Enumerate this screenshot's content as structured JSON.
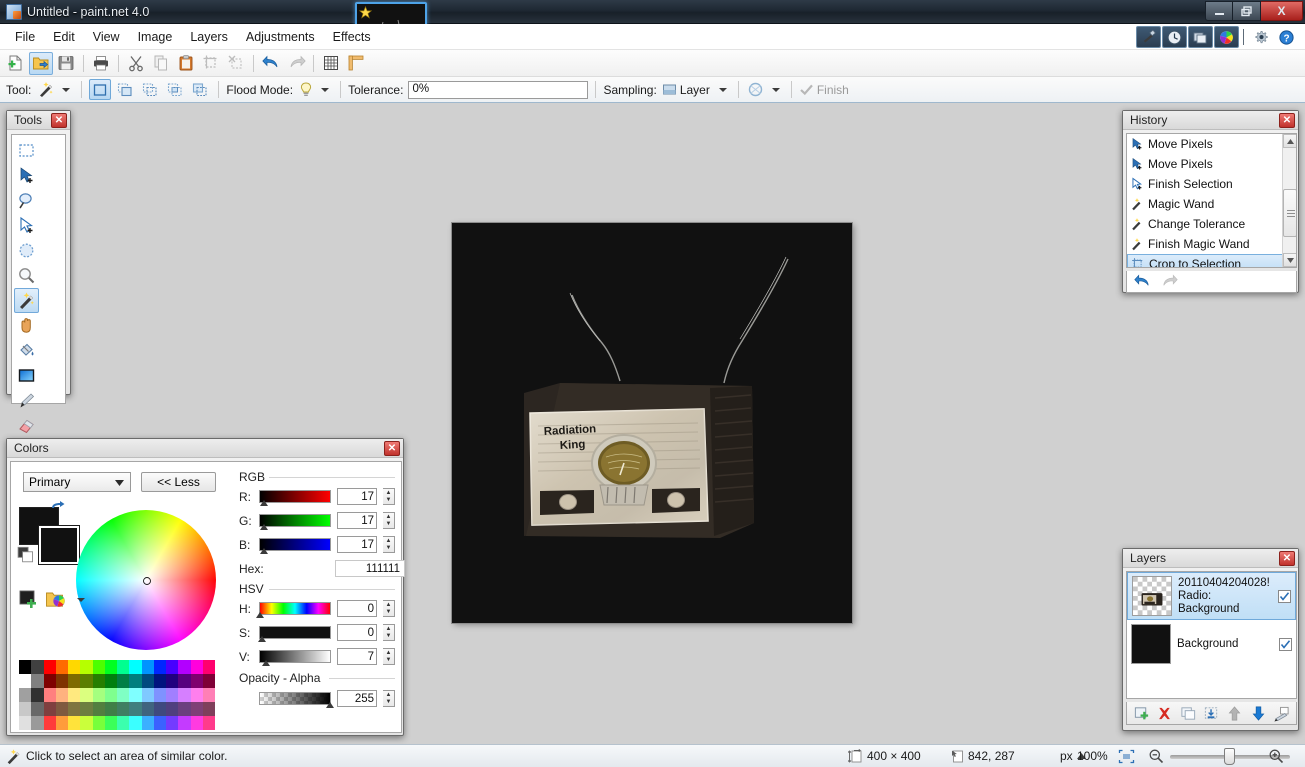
{
  "window": {
    "title": "Untitled - paint.net 4.0",
    "minimize_label": "—",
    "maximize_label": "❐",
    "close_label": "X"
  },
  "menu": {
    "items": [
      {
        "label": "File"
      },
      {
        "label": "Edit"
      },
      {
        "label": "View"
      },
      {
        "label": "Image"
      },
      {
        "label": "Layers"
      },
      {
        "label": "Adjustments"
      },
      {
        "label": "Effects"
      }
    ]
  },
  "toolbar": {
    "buttons": [
      {
        "name": "new-image",
        "icon": "new-page-icon",
        "selected": false
      },
      {
        "name": "open-image",
        "icon": "open-folder-icon",
        "selected": true
      },
      {
        "name": "save-image",
        "icon": "floppy-disk-icon",
        "selected": false
      },
      {
        "name": "print-image",
        "icon": "printer-icon",
        "selected": false
      },
      {
        "name": "cut",
        "icon": "scissors-icon",
        "selected": false
      },
      {
        "name": "copy",
        "icon": "copy-icon",
        "selected": false
      },
      {
        "name": "paste",
        "icon": "clipboard-icon",
        "selected": false
      },
      {
        "name": "crop-to-selection",
        "icon": "crop-icon",
        "selected": false
      },
      {
        "name": "deselect-all",
        "icon": "deselect-icon",
        "selected": false
      },
      {
        "name": "undo",
        "icon": "undo-arrow-icon",
        "selected": false
      },
      {
        "name": "redo",
        "icon": "redo-arrow-icon",
        "selected": false
      },
      {
        "name": "grid",
        "icon": "grid-icon",
        "selected": false
      },
      {
        "name": "rulers",
        "icon": "rulers-icon",
        "selected": false
      }
    ]
  },
  "options_bar": {
    "tool_label": "Tool:",
    "tool_icon": "magic-wand-icon",
    "selection_modes": [
      {
        "name": "replace-selection",
        "selected": true
      },
      {
        "name": "union-selection",
        "selected": false
      },
      {
        "name": "exclude-selection",
        "selected": false
      },
      {
        "name": "intersect-selection",
        "selected": false
      },
      {
        "name": "xor-selection",
        "selected": false
      }
    ],
    "flood_mode_label": "Flood Mode:",
    "flood_mode_icon": "lightbulb-icon",
    "tolerance_label": "Tolerance:",
    "tolerance_value": "0%",
    "sampling_label": "Sampling:",
    "sampling_value": "Layer",
    "antialias_icon": "antialiasing-icon",
    "finish_label": "Finish",
    "finish_icon": "checkmark-icon"
  },
  "quick_panels": [
    {
      "name": "tools-toggle",
      "icon": "hammer-wrench-icon",
      "active": true
    },
    {
      "name": "history-toggle",
      "icon": "clock-icon",
      "active": true
    },
    {
      "name": "layers-toggle",
      "icon": "layers-stack-icon",
      "active": true
    },
    {
      "name": "colors-toggle",
      "icon": "color-wheel-icon",
      "active": true
    },
    {
      "name": "settings",
      "icon": "gear-icon",
      "active": false
    },
    {
      "name": "help",
      "icon": "question-mark-icon",
      "active": false
    }
  ],
  "tools_panel": {
    "title": "Tools",
    "tools": [
      {
        "name": "rectangle-select-tool",
        "icon": "rectangle-select-icon",
        "selected": false
      },
      {
        "name": "move-selected-tool",
        "icon": "move-arrow-icon",
        "selected": false
      },
      {
        "name": "lasso-select-tool",
        "icon": "lasso-icon",
        "selected": false
      },
      {
        "name": "move-selection-tool",
        "icon": "move-selection-icon",
        "selected": false
      },
      {
        "name": "ellipse-select-tool",
        "icon": "ellipse-select-icon",
        "selected": false
      },
      {
        "name": "zoom-tool",
        "icon": "magnifier-icon",
        "selected": false
      },
      {
        "name": "magic-wand-tool",
        "icon": "magic-wand-icon",
        "selected": true
      },
      {
        "name": "pan-tool",
        "icon": "hand-icon",
        "selected": false
      },
      {
        "name": "paint-bucket-tool",
        "icon": "paint-bucket-icon",
        "selected": false
      },
      {
        "name": "gradient-tool",
        "icon": "gradient-icon",
        "selected": false
      },
      {
        "name": "paintbrush-tool",
        "icon": "paintbrush-icon",
        "selected": false
      },
      {
        "name": "eraser-tool",
        "icon": "eraser-icon",
        "selected": false
      },
      {
        "name": "pencil-tool",
        "icon": "pencil-icon",
        "selected": false
      },
      {
        "name": "color-picker-tool",
        "icon": "eyedropper-icon",
        "selected": false
      },
      {
        "name": "clone-stamp-tool",
        "icon": "clone-stamp-icon",
        "selected": false
      },
      {
        "name": "recolor-tool",
        "icon": "recolor-icon",
        "selected": false
      },
      {
        "name": "text-tool",
        "icon": "text-t-icon",
        "selected": false
      },
      {
        "name": "line-curve-tool",
        "icon": "line-curve-icon",
        "selected": false
      },
      {
        "name": "shapes-tool",
        "icon": "shapes-icon",
        "selected": false
      }
    ]
  },
  "history_panel": {
    "title": "History",
    "items": [
      {
        "label": "Move Pixels",
        "icon": "move-arrow-icon",
        "selected": false
      },
      {
        "label": "Move Pixels",
        "icon": "move-arrow-icon",
        "selected": false
      },
      {
        "label": "Finish Selection",
        "icon": "move-arrow-icon",
        "selected": false
      },
      {
        "label": "Magic Wand",
        "icon": "magic-wand-icon",
        "selected": false
      },
      {
        "label": "Change Tolerance",
        "icon": "magic-wand-icon",
        "selected": false
      },
      {
        "label": "Finish Magic Wand",
        "icon": "magic-wand-icon",
        "selected": false
      },
      {
        "label": "Crop to Selection",
        "icon": "crop-icon",
        "selected": true
      }
    ],
    "undo_icon": "undo-arrow-icon",
    "redo_icon": "redo-arrow-icon"
  },
  "layers_panel": {
    "title": "Layers",
    "layers": [
      {
        "name_line1": "20110404204028!",
        "name_line2": "Radio: Background",
        "visible": true,
        "selected": true,
        "thumbnail": "radio-transparent-thumb"
      },
      {
        "name_line1": "Background",
        "name_line2": "",
        "visible": true,
        "selected": false,
        "thumbnail": "black-thumb"
      }
    ],
    "buttons": [
      {
        "name": "add-new-layer",
        "icon": "add-layer-icon"
      },
      {
        "name": "delete-layer",
        "icon": "delete-layer-icon"
      },
      {
        "name": "duplicate-layer",
        "icon": "duplicate-layer-icon"
      },
      {
        "name": "merge-layer-down",
        "icon": "merge-down-icon"
      },
      {
        "name": "move-layer-up",
        "icon": "arrow-up-icon"
      },
      {
        "name": "move-layer-down",
        "icon": "arrow-down-icon"
      },
      {
        "name": "layer-properties",
        "icon": "layer-properties-icon"
      }
    ]
  },
  "colors_panel": {
    "title": "Colors",
    "mode_value": "Primary",
    "less_label": "<< Less",
    "primary_color": "#111111",
    "secondary_color": "#111111",
    "rgb_group_label": "RGB",
    "hsv_group_label": "HSV",
    "opacity_group_label": "Opacity - Alpha",
    "hex_label": "Hex:",
    "hex_value": "111111",
    "channels": [
      {
        "label": "R:",
        "value": "17",
        "name": "red-channel"
      },
      {
        "label": "G:",
        "value": "17",
        "name": "green-channel"
      },
      {
        "label": "B:",
        "value": "17",
        "name": "blue-channel"
      }
    ],
    "hsv_channels": [
      {
        "label": "H:",
        "value": "0",
        "name": "hue-channel"
      },
      {
        "label": "S:",
        "value": "0",
        "name": "saturation-channel"
      },
      {
        "label": "V:",
        "value": "7",
        "name": "value-channel"
      }
    ],
    "alpha_value": "255",
    "palette_colors": [
      "#000000",
      "#404040",
      "#ff0000",
      "#ff6a00",
      "#ffd800",
      "#b6ff00",
      "#4cff00",
      "#00ff21",
      "#00ff90",
      "#00ffff",
      "#0094ff",
      "#0026ff",
      "#4800ff",
      "#b200ff",
      "#ff00dc",
      "#ff006e",
      "#ffffff",
      "#808080",
      "#7f0000",
      "#7f3300",
      "#7f6a00",
      "#5b7f00",
      "#267f00",
      "#007f0e",
      "#007f46",
      "#007f7f",
      "#004a7f",
      "#00137f",
      "#21007f",
      "#57007f",
      "#7f006e",
      "#7f0037",
      "#a0a0a0",
      "#303030",
      "#ff7f7f",
      "#ffb27f",
      "#ffe97f",
      "#dbff7f",
      "#a5ff7f",
      "#7fff8e",
      "#7fffc4",
      "#7fffff",
      "#7fc9ff",
      "#7f92ff",
      "#a17fff",
      "#d67fff",
      "#ff7fed",
      "#ff7fb6",
      "#c8c8c8",
      "#686868",
      "#7f3f3f",
      "#7f593f",
      "#7f743f",
      "#6d7f3f",
      "#527f3f",
      "#3f7f47",
      "#3f7f62",
      "#3f7f7f",
      "#3f647f",
      "#3f497f",
      "#503f7f",
      "#6b3f7f",
      "#7f3f76",
      "#7f3f5b",
      "#e0e0e0",
      "#9a9a9a",
      "#ff3b3b",
      "#ff9c3b",
      "#ffe33b",
      "#caff3b",
      "#78ff3b",
      "#3bff59",
      "#3bffae",
      "#3bffff",
      "#3bb0ff",
      "#3b62ff",
      "#743bff",
      "#c43bff",
      "#ff3be0",
      "#ff3b8c"
    ]
  },
  "canvas": {
    "background_color": "#111111",
    "image_title": "Radiation King",
    "image_line1": "Radiation",
    "image_line2": "King"
  },
  "status_bar": {
    "hint_icon": "magic-wand-icon",
    "hint_text": "Click to select an area of similar color.",
    "size_icon": "image-size-icon",
    "size_text": "400 × 400",
    "cursor_icon": "cursor-position-icon",
    "cursor_text": "842, 287",
    "units": "px",
    "zoom_value": "100%",
    "fit_icon": "fit-to-window-icon",
    "zoom_out_icon": "zoom-out-icon",
    "zoom_in_icon": "zoom-in-icon"
  }
}
